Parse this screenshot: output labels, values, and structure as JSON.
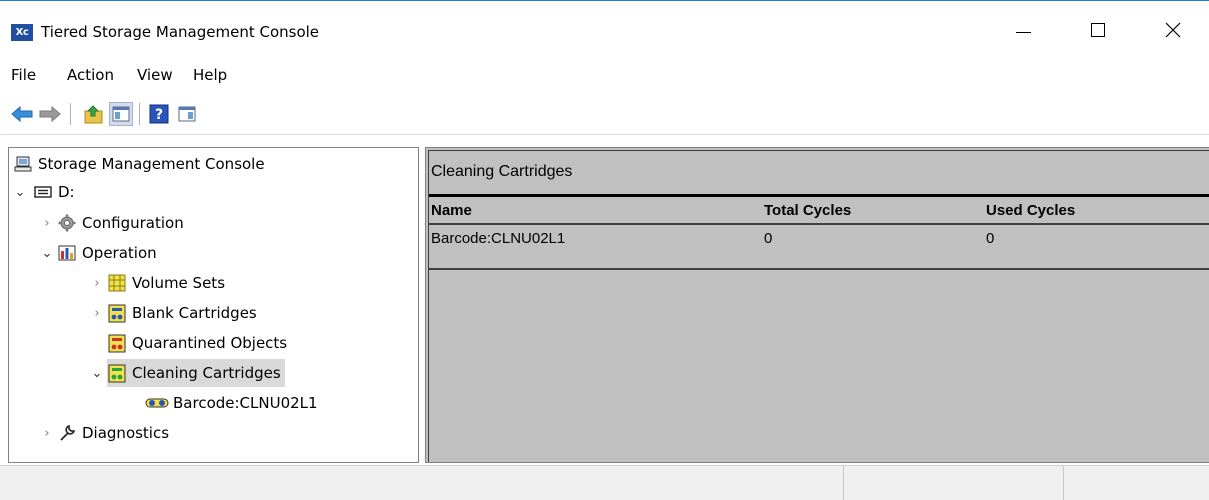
{
  "window": {
    "icon_label": "Xc",
    "title": "Tiered Storage Management Console"
  },
  "menu": {
    "items": [
      "File",
      "Action",
      "View",
      "Help"
    ]
  },
  "toolbar": {
    "buttons": [
      "back-icon",
      "forward-icon",
      "up-folder-icon",
      "show-hide-tree-icon",
      "help-icon",
      "action-pane-icon"
    ]
  },
  "tree": {
    "root": "Storage Management Console",
    "drive": "D:",
    "configuration": "Configuration",
    "operation": "Operation",
    "volume_sets": "Volume Sets",
    "blank_cartridges": "Blank Cartridges",
    "quarantined_objects": "Quarantined Objects",
    "cleaning_cartridges": "Cleaning Cartridges",
    "barcode_item": "Barcode:CLNU02L1",
    "diagnostics": "Diagnostics"
  },
  "result": {
    "title": "Cleaning Cartridges",
    "columns": [
      "Name",
      "Total Cycles",
      "Used Cycles"
    ],
    "rows": [
      [
        "Barcode:CLNU02L1",
        "0",
        "0"
      ]
    ]
  },
  "colors": {
    "accent": "#1e7bd6",
    "selection": "#d9d9d9",
    "result_bg": "#c0c0c0"
  }
}
